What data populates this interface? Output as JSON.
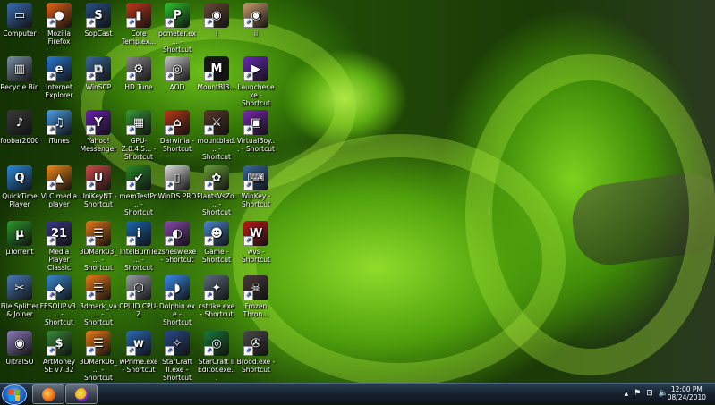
{
  "desktop": {
    "icons": [
      {
        "label": "Computer",
        "col": 0,
        "row": 0,
        "icon": "computer-icon",
        "color": "#3b6fb6",
        "glyph": "▭",
        "shortcut": false
      },
      {
        "label": "Mozilla Firefox",
        "col": 1,
        "row": 0,
        "icon": "firefox-icon",
        "color": "#e8641a",
        "glyph": "●",
        "shortcut": true
      },
      {
        "label": "SopCast",
        "col": 2,
        "row": 0,
        "icon": "sopcast-icon",
        "color": "#2b4f86",
        "glyph": "S",
        "shortcut": true
      },
      {
        "label": "Core Temp.ex...",
        "col": 3,
        "row": 0,
        "icon": "core-temp-icon",
        "color": "#c23a1c",
        "glyph": "▮",
        "shortcut": true
      },
      {
        "label": "pcmeter.ex... - Shortcut",
        "col": 4,
        "row": 0,
        "icon": "pcmeter-icon",
        "color": "#2ec82e",
        "glyph": "P",
        "shortcut": true
      },
      {
        "label": "i",
        "col": 5,
        "row": 0,
        "icon": "image-file-icon",
        "color": "#6a4a3a",
        "glyph": "◉",
        "shortcut": true
      },
      {
        "label": "ii",
        "col": 6,
        "row": 0,
        "icon": "image-file-icon",
        "color": "#caa070",
        "glyph": "◉",
        "shortcut": true
      },
      {
        "label": "Recycle Bin",
        "col": 0,
        "row": 1,
        "icon": "recycle-bin-icon",
        "color": "#7a8fa6",
        "glyph": "▥",
        "shortcut": false
      },
      {
        "label": "Internet Explorer",
        "col": 1,
        "row": 1,
        "icon": "internet-explorer-icon",
        "color": "#2a7ad6",
        "glyph": "e",
        "shortcut": true
      },
      {
        "label": "WinSCP",
        "col": 2,
        "row": 1,
        "icon": "winscp-icon",
        "color": "#3a6a9a",
        "glyph": "⧉",
        "shortcut": true
      },
      {
        "label": "HD Tune",
        "col": 3,
        "row": 1,
        "icon": "hd-tune-icon",
        "color": "#8a8a8a",
        "glyph": "⚙",
        "shortcut": true
      },
      {
        "label": "AOD",
        "col": 4,
        "row": 1,
        "icon": "aod-icon",
        "color": "#c8c8c8",
        "glyph": "◎",
        "shortcut": true
      },
      {
        "label": "MountBlB...",
        "col": 5,
        "row": 1,
        "icon": "mount-blade-icon",
        "color": "#1a1a1a",
        "glyph": "M",
        "shortcut": true
      },
      {
        "label": "Launcher.exe - Shortcut",
        "col": 6,
        "row": 1,
        "icon": "launcher-icon",
        "color": "#6a2ab8",
        "glyph": "▶",
        "shortcut": true
      },
      {
        "label": "foobar2000",
        "col": 0,
        "row": 2,
        "icon": "foobar2000-icon",
        "color": "#3a3a3a",
        "glyph": "♪",
        "shortcut": false
      },
      {
        "label": "iTunes",
        "col": 1,
        "row": 2,
        "icon": "itunes-icon",
        "color": "#4aa0e8",
        "glyph": "♫",
        "shortcut": true
      },
      {
        "label": "Yahoo! Messenger",
        "col": 2,
        "row": 2,
        "icon": "yahoo-messenger-icon",
        "color": "#6a1fb0",
        "glyph": "Y",
        "shortcut": true
      },
      {
        "label": "GPU-Z.0.4.5... - Shortcut",
        "col": 3,
        "row": 2,
        "icon": "gpu-z-icon",
        "color": "#3a9a3a",
        "glyph": "▦",
        "shortcut": true
      },
      {
        "label": "Darwinia - Shortcut",
        "col": 4,
        "row": 2,
        "icon": "darwinia-icon",
        "color": "#b83a1a",
        "glyph": "⌂",
        "shortcut": true
      },
      {
        "label": "mountblad... - Shortcut",
        "col": 5,
        "row": 2,
        "icon": "mount-blade-icon",
        "color": "#5a3a2a",
        "glyph": "⚔",
        "shortcut": true
      },
      {
        "label": "VirtualBoy... - Shortcut",
        "col": 6,
        "row": 2,
        "icon": "virtualboy-icon",
        "color": "#7a2ab0",
        "glyph": "▣",
        "shortcut": true
      },
      {
        "label": "QuickTime Player",
        "col": 0,
        "row": 3,
        "icon": "quicktime-icon",
        "color": "#2a8ae0",
        "glyph": "Q",
        "shortcut": false
      },
      {
        "label": "VLC media player",
        "col": 1,
        "row": 3,
        "icon": "vlc-icon",
        "color": "#f08a1a",
        "glyph": "▲",
        "shortcut": true
      },
      {
        "label": "UniKeyNT - Shortcut",
        "col": 2,
        "row": 3,
        "icon": "unikey-icon",
        "color": "#d04a4a",
        "glyph": "U",
        "shortcut": true
      },
      {
        "label": "memTestPr... - Shortcut",
        "col": 3,
        "row": 3,
        "icon": "memtest-icon",
        "color": "#2a8a2a",
        "glyph": "✔",
        "shortcut": true
      },
      {
        "label": "WinDS PRO",
        "col": 4,
        "row": 3,
        "icon": "winds-pro-icon",
        "color": "#e0e0e0",
        "glyph": "▯",
        "shortcut": true
      },
      {
        "label": "PlantsVsZo... - Shortcut",
        "col": 5,
        "row": 3,
        "icon": "plants-vs-zombies-icon",
        "color": "#6aa03a",
        "glyph": "✿",
        "shortcut": true
      },
      {
        "label": "WinKey - Shortcut",
        "col": 6,
        "row": 3,
        "icon": "winkey-icon",
        "color": "#3a6aa0",
        "glyph": "⌨",
        "shortcut": true
      },
      {
        "label": "µTorrent",
        "col": 0,
        "row": 4,
        "icon": "utorrent-icon",
        "color": "#2a9a2a",
        "glyph": "µ",
        "shortcut": false
      },
      {
        "label": "Media Player Classic",
        "col": 1,
        "row": 4,
        "icon": "media-player-classic-icon",
        "color": "#3a3a8a",
        "glyph": "21",
        "shortcut": true
      },
      {
        "label": "3DMark03_... - Shortcut",
        "col": 2,
        "row": 4,
        "icon": "3dmark-icon",
        "color": "#e87a1a",
        "glyph": "☰",
        "shortcut": true
      },
      {
        "label": "IntelBurnTe... - Shortcut",
        "col": 3,
        "row": 4,
        "icon": "intel-burn-test-icon",
        "color": "#1a6ab8",
        "glyph": "i",
        "shortcut": true
      },
      {
        "label": "zsnesw.exe - Shortcut",
        "col": 4,
        "row": 4,
        "icon": "zsnes-icon",
        "color": "#8a4ab0",
        "glyph": "◐",
        "shortcut": true
      },
      {
        "label": "Game - Shortcut",
        "col": 5,
        "row": 4,
        "icon": "game-icon",
        "color": "#4a8ad0",
        "glyph": "☻",
        "shortcut": true
      },
      {
        "label": "wvs - Shortcut",
        "col": 6,
        "row": 4,
        "icon": "wvs-icon",
        "color": "#c01a1a",
        "glyph": "W",
        "shortcut": true
      },
      {
        "label": "File Splitter & Joiner",
        "col": 0,
        "row": 5,
        "icon": "file-splitter-icon",
        "color": "#4a7ab8",
        "glyph": "✂",
        "shortcut": false
      },
      {
        "label": "FESOUP.v3... - Shortcut",
        "col": 1,
        "row": 5,
        "icon": "fesoup-icon",
        "color": "#3a8ad0",
        "glyph": "◆",
        "shortcut": true
      },
      {
        "label": "3dmark_va... - Shortcut",
        "col": 2,
        "row": 5,
        "icon": "3dmark-icon",
        "color": "#e87a1a",
        "glyph": "☰",
        "shortcut": true
      },
      {
        "label": "CPUID CPU-Z",
        "col": 3,
        "row": 5,
        "icon": "cpu-z-icon",
        "color": "#9aa0a8",
        "glyph": "⬡",
        "shortcut": true
      },
      {
        "label": "Dolphin.exe - Shortcut",
        "col": 4,
        "row": 5,
        "icon": "dolphin-icon",
        "color": "#3a8ae8",
        "glyph": "◗",
        "shortcut": true
      },
      {
        "label": "cstrike.exe - Shortcut",
        "col": 5,
        "row": 5,
        "icon": "counter-strike-icon",
        "color": "#5a6a7a",
        "glyph": "✦",
        "shortcut": true
      },
      {
        "label": "Frozen Thron...",
        "col": 6,
        "row": 5,
        "icon": "frozen-throne-icon",
        "color": "#4a3a3a",
        "glyph": "☠",
        "shortcut": true
      },
      {
        "label": "UltraISO",
        "col": 0,
        "row": 6,
        "icon": "ultraiso-icon",
        "color": "#8a7ab8",
        "glyph": "◉",
        "shortcut": false
      },
      {
        "label": "ArtMoney SE v7.32",
        "col": 1,
        "row": 6,
        "icon": "artmoney-icon",
        "color": "#3a8a3a",
        "glyph": "$",
        "shortcut": true
      },
      {
        "label": "3DMark06_... - Shortcut",
        "col": 2,
        "row": 6,
        "icon": "3dmark-icon",
        "color": "#e87a1a",
        "glyph": "☰",
        "shortcut": true
      },
      {
        "label": "wPrime.exe - Shortcut",
        "col": 3,
        "row": 6,
        "icon": "wprime-icon",
        "color": "#2a6ab8",
        "glyph": "w",
        "shortcut": true
      },
      {
        "label": "StarCraft II.exe - Shortcut",
        "col": 4,
        "row": 6,
        "icon": "starcraft-icon",
        "color": "#2a4a8a",
        "glyph": "✧",
        "shortcut": true
      },
      {
        "label": "StarCraft II Editor.exe...",
        "col": 5,
        "row": 6,
        "icon": "starcraft-editor-icon",
        "color": "#1a7a3a",
        "glyph": "◎",
        "shortcut": true
      },
      {
        "label": "Brood.exe - Shortcut",
        "col": 6,
        "row": 6,
        "icon": "brood-war-icon",
        "color": "#4a4a4a",
        "glyph": "✇",
        "shortcut": true
      }
    ]
  },
  "taskbar": {
    "start_icon": "windows-start-icon",
    "pinned": [
      {
        "name": "taskbar-firefox-button",
        "icon": "firefox-icon",
        "color": "#e8641a"
      },
      {
        "name": "taskbar-yahoo-messenger-button",
        "icon": "yahoo-messenger-icon",
        "color": "#7a2ac8"
      }
    ],
    "tray": {
      "chevron": "▲",
      "flag": "⚑",
      "network": "⊡",
      "volume": "🔈"
    },
    "clock": {
      "time": "12:00 PM",
      "date": "08/24/2010"
    }
  }
}
